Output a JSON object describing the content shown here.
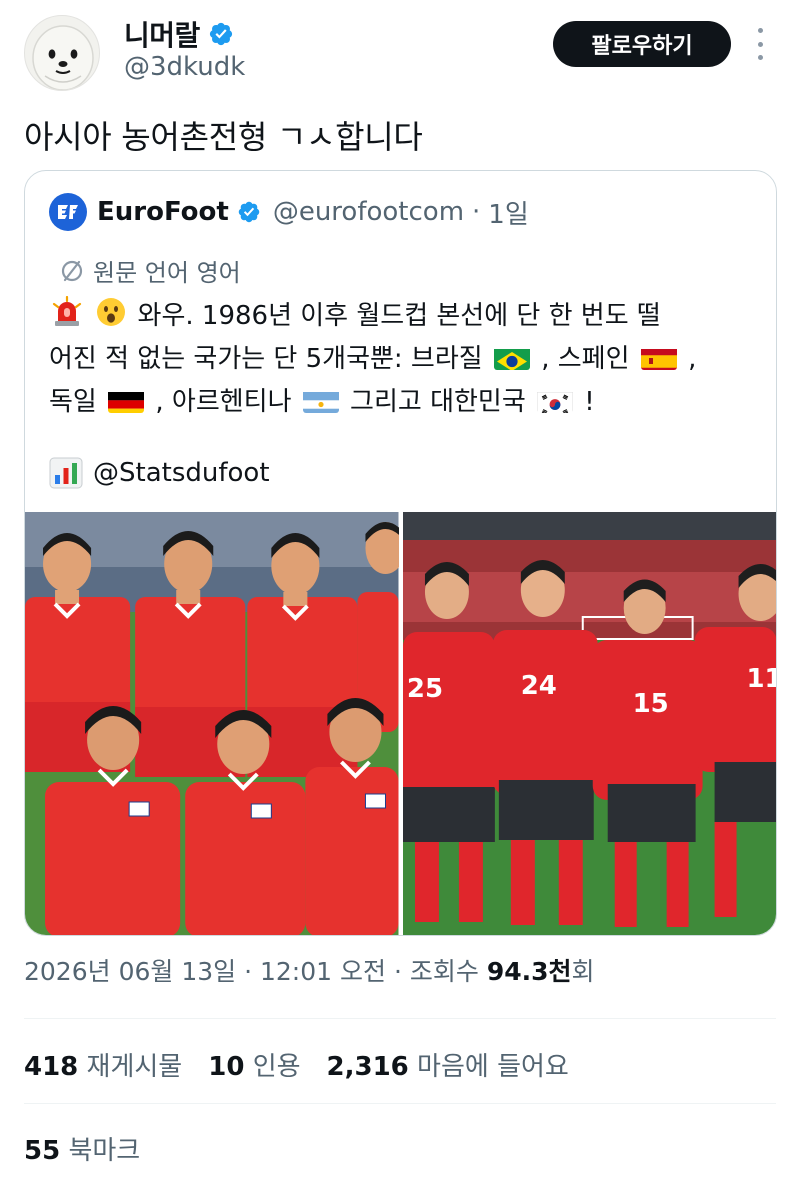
{
  "header": {
    "avatar_icon": "seal-face-avatar",
    "display_name": "니머랄",
    "handle": "@3dkudk",
    "verified_icon": "verified-badge-icon",
    "follow_label": "팔로우하기",
    "more_icon": "more-vertical-icon"
  },
  "tweet": {
    "text": "아시아 농어촌전형 ㄱㅅ합니다"
  },
  "quote": {
    "name": "EuroFoot",
    "handle": "@eurofootcom",
    "separator": "·",
    "time": "1일",
    "translate_label": "원문 언어 영어",
    "line1_text": "와우. 1986년 이후 월드컵 본선에 단 한 번도 떨",
    "line2_a": "어진 적 없는 국가는 단 5개국뿐: 브라질",
    "line2_b": ", 스페인",
    "line2_c": ",",
    "line3_a": "독일",
    "line3_b": ", 아르헨티나",
    "line3_c": "그리고 대한민국",
    "line3_d": "!",
    "stats_mention": "@Statsdufoot",
    "flags": [
      "brazil-flag-icon",
      "spain-flag-icon",
      "germany-flag-icon",
      "argentina-flag-icon",
      "korea-flag-icon"
    ],
    "media": [
      {
        "alt_icon": "retro-korea-team-photo",
        "jersey_numbers": []
      },
      {
        "alt_icon": "modern-korea-team-photo",
        "jersey_numbers": [
          "25",
          "24",
          "15",
          "11"
        ]
      }
    ]
  },
  "meta": {
    "date": "2026년 06월 13일",
    "dot1": "·",
    "time": "12:01 오전",
    "dot2": "·",
    "views_label": "조회수",
    "views_value": "94.3천",
    "views_suffix": "회"
  },
  "engagement": {
    "reposts_count": "418",
    "reposts_label": "재게시물",
    "quotes_count": "10",
    "quotes_label": "인용",
    "likes_count": "2,316",
    "likes_label": "마음에 들어요",
    "bookmarks_count": "55",
    "bookmarks_label": "북마크"
  },
  "colors": {
    "verified": "#1d9bf0",
    "text_primary": "#0f1419",
    "text_secondary": "#536471",
    "border": "#cfd9de",
    "jersey_red": "#e0262c"
  }
}
